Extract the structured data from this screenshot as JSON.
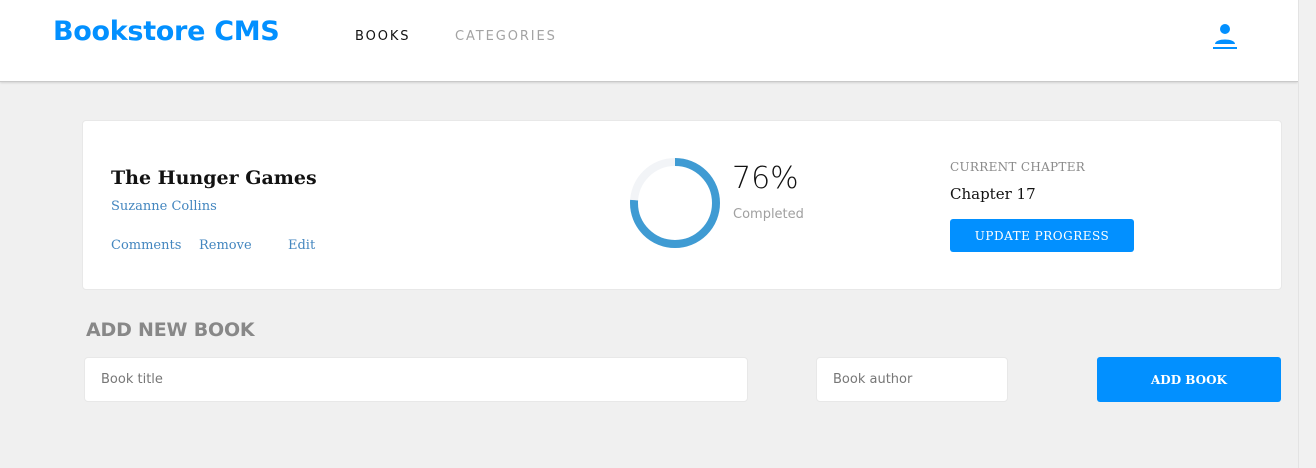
{
  "app": {
    "title": "Bookstore CMS",
    "accent_color": "#0290ff",
    "link_color": "#4386bf",
    "background_color": "#f0f0f0"
  },
  "nav": {
    "items": [
      {
        "label": "BOOKS",
        "active": true
      },
      {
        "label": "CATEGORIES",
        "active": false
      }
    ],
    "user_icon": "user-icon"
  },
  "book": {
    "title": "The Hunger Games",
    "author": "Suzanne Collins",
    "actions": {
      "comments": "Comments",
      "remove": "Remove",
      "edit": "Edit"
    },
    "progress": {
      "percent": 76,
      "percent_label": "76%",
      "status": "Completed",
      "ring_color": "#3f9bd3",
      "track_color": "#f2f4f7"
    },
    "chapter": {
      "label": "CURRENT CHAPTER",
      "value": "Chapter 17",
      "button": "UPDATE PROGRESS"
    }
  },
  "add_book": {
    "heading": "ADD NEW BOOK",
    "title_placeholder": "Book title",
    "author_placeholder": "Book author",
    "button": "ADD BOOK"
  }
}
